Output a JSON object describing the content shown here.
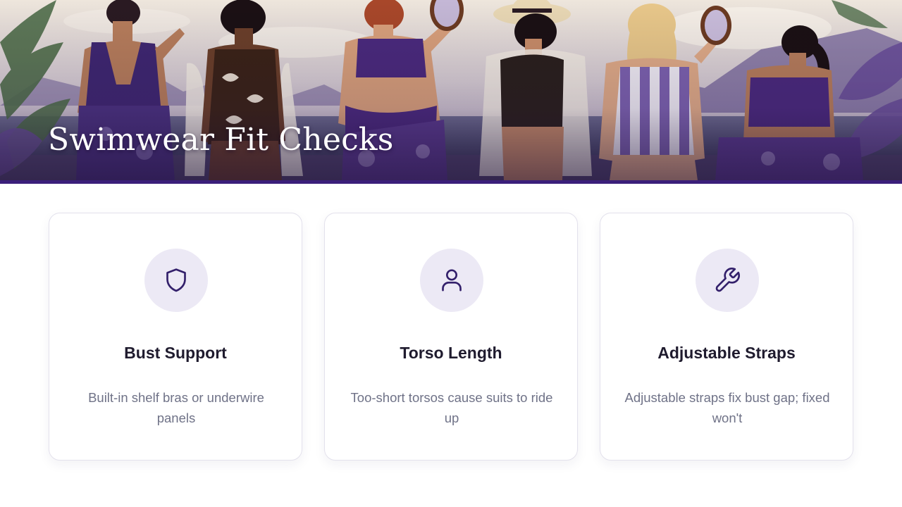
{
  "hero": {
    "title": "Swimwear Fit Checks"
  },
  "colors": {
    "accent": "#3b1f7a",
    "icon_bg": "#ece9f5",
    "icon_stroke": "#33206b",
    "card_border": "#e3e1ec",
    "title_text": "#1f1b2e",
    "body_text": "#6f7287"
  },
  "cards": [
    {
      "icon": "shield-icon",
      "title": "Bust Support",
      "description": "Built-in shelf bras or underwire panels"
    },
    {
      "icon": "user-icon",
      "title": "Torso Length",
      "description": "Too-short torsos cause suits to ride up"
    },
    {
      "icon": "wrench-icon",
      "title": "Adjustable Straps",
      "description": "Adjustable straps fix bust gap; fixed won't"
    }
  ]
}
